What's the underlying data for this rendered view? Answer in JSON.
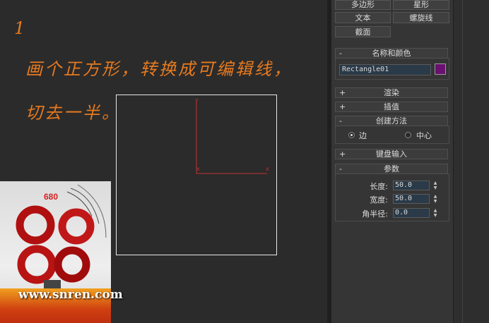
{
  "viewport": {
    "step_number": "1",
    "note_line1": "画个正方形，转换成可编辑线，",
    "note_line2": "切去一半。",
    "axis_y": "y",
    "axis_x1": "x",
    "axis_x2": "x",
    "photo_label": "680",
    "watermark": "www.snren.com"
  },
  "object_types": {
    "buttons": [
      "多边形",
      "星形",
      "文本",
      "螺旋线",
      "截面"
    ]
  },
  "name_color": {
    "title": "名称和颜色",
    "name_value": "Rectangle01",
    "color": "#6a1070"
  },
  "rollouts": {
    "rendering": "渲染",
    "interpolation": "插值",
    "creation_method": "创建方法",
    "keyboard_entry": "键盘输入",
    "parameters": "参数"
  },
  "creation_method": {
    "option_edge": "边",
    "option_center": "中心",
    "selected": "边"
  },
  "parameters": {
    "length_label": "长度:",
    "length_value": "50.0",
    "width_label": "宽度:",
    "width_value": "50.0",
    "corner_label": "角半径:",
    "corner_value": "0.0"
  },
  "signs": {
    "plus": "+",
    "minus": "-"
  }
}
